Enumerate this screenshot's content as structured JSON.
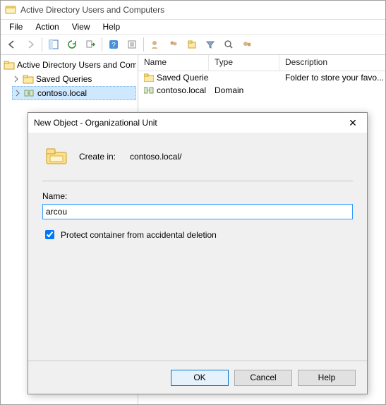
{
  "titlebar": {
    "title": "Active Directory Users and Computers"
  },
  "menubar": {
    "items": [
      "File",
      "Action",
      "View",
      "Help"
    ]
  },
  "tree": {
    "root": "Active Directory Users and Com",
    "items": [
      "Saved Queries",
      "contoso.local"
    ]
  },
  "list": {
    "headers": {
      "name": "Name",
      "type": "Type",
      "desc": "Description"
    },
    "rows": [
      {
        "name": "Saved Queries",
        "type": "",
        "desc": "Folder to store your favo..."
      },
      {
        "name": "contoso.local",
        "type": "Domain",
        "desc": ""
      }
    ]
  },
  "dialog": {
    "title": "New Object - Organizational Unit",
    "create_in_label": "Create in:",
    "create_in_path": "contoso.local/",
    "name_label": "Name:",
    "name_value": "arcou",
    "protect_label": "Protect container from accidental deletion",
    "protect_checked": true,
    "buttons": {
      "ok": "OK",
      "cancel": "Cancel",
      "help": "Help"
    }
  }
}
